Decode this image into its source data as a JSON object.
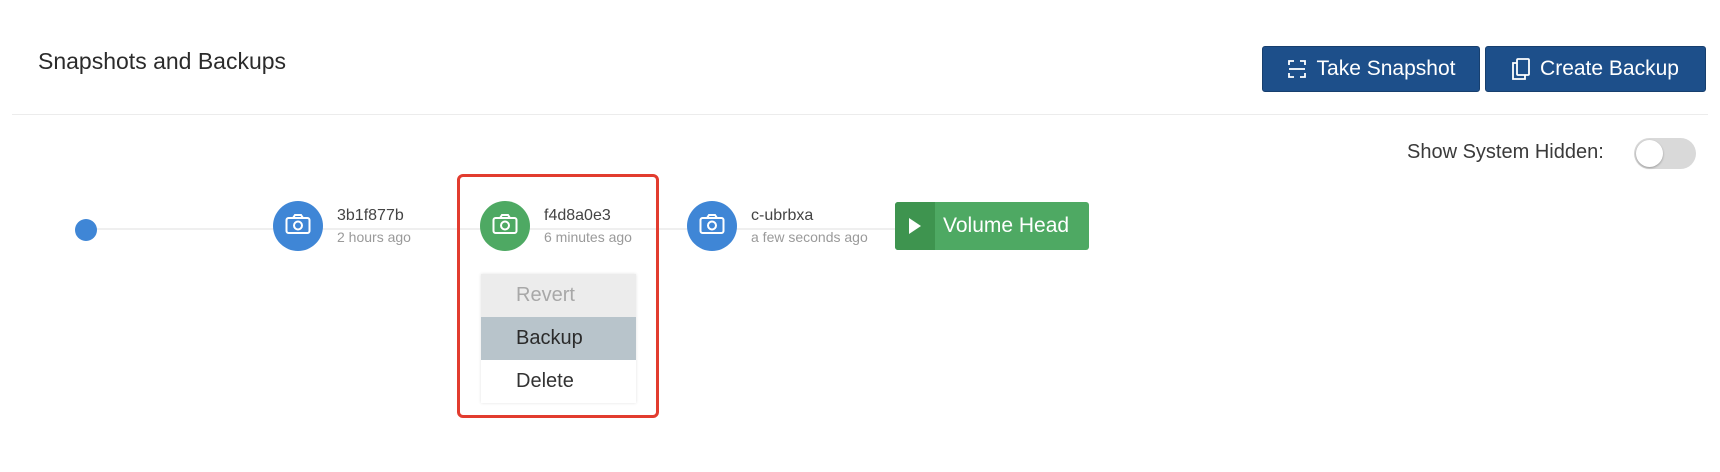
{
  "header": {
    "title": "Snapshots and Backups",
    "take_snapshot_label": "Take Snapshot",
    "create_backup_label": "Create Backup"
  },
  "toolbar": {
    "show_system_hidden_label": "Show System Hidden:",
    "show_system_hidden_on": false
  },
  "snapshots": [
    {
      "name": "3b1f877b",
      "time": "2 hours ago",
      "color": "#3f86d6",
      "icon": "camera-icon"
    },
    {
      "name": "f4d8a0e3",
      "time": "6 minutes ago",
      "color": "#4ea963",
      "icon": "camera-icon",
      "selected": true
    },
    {
      "name": "c-ubrbxa",
      "time": "a few seconds ago",
      "color": "#3f86d6",
      "icon": "camera-icon"
    }
  ],
  "volume_head": {
    "label": "Volume Head",
    "icon": "play-icon"
  },
  "context_menu": {
    "items": [
      {
        "label": "Revert",
        "state": "disabled"
      },
      {
        "label": "Backup",
        "state": "hover"
      },
      {
        "label": "Delete",
        "state": "normal"
      }
    ]
  },
  "colors": {
    "primary_button": "#1d4f8a",
    "snapshot_blue": "#3f86d6",
    "selected_green": "#4ea963",
    "highlight_red": "#e23c2f"
  }
}
